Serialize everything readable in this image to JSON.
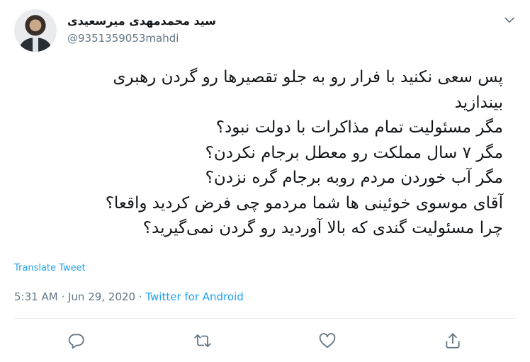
{
  "author": {
    "display_name": "سید محمدمهدی میرسعیدی",
    "handle": "@9351359053mahdi"
  },
  "tweet": {
    "lines": [
      "پس سعی نکنید با فرار رو به جلو تقصیرها رو گردن رهبری",
      "بیندازید",
      "مگر مسئولیت تمام مذاکرات با دولت نبود؟",
      "مگر ۷ سال مملکت رو معطل برجام نکردن؟",
      "مگر آب خوردن مردم روبه برجام گره نزدن؟",
      "آقای موسوی خوئینی ها شما مردمو چی فرض کردید واقعا؟",
      "چرا مسئولیت گندی که بالا آوردید رو گردن نمی‌گیرید؟"
    ],
    "translate_label": "Translate Tweet",
    "time": "5:31 AM",
    "date": "Jun 29, 2020",
    "separator": "·",
    "source": "Twitter for Android"
  },
  "icons": {
    "caret": "chevron-down-icon",
    "reply": "reply-icon",
    "retweet": "retweet-icon",
    "like": "heart-icon",
    "share": "share-icon"
  },
  "colors": {
    "link": "#1da1f2",
    "secondary_text": "#657786",
    "primary_text": "#14171a",
    "divider": "#e6ecf0"
  }
}
